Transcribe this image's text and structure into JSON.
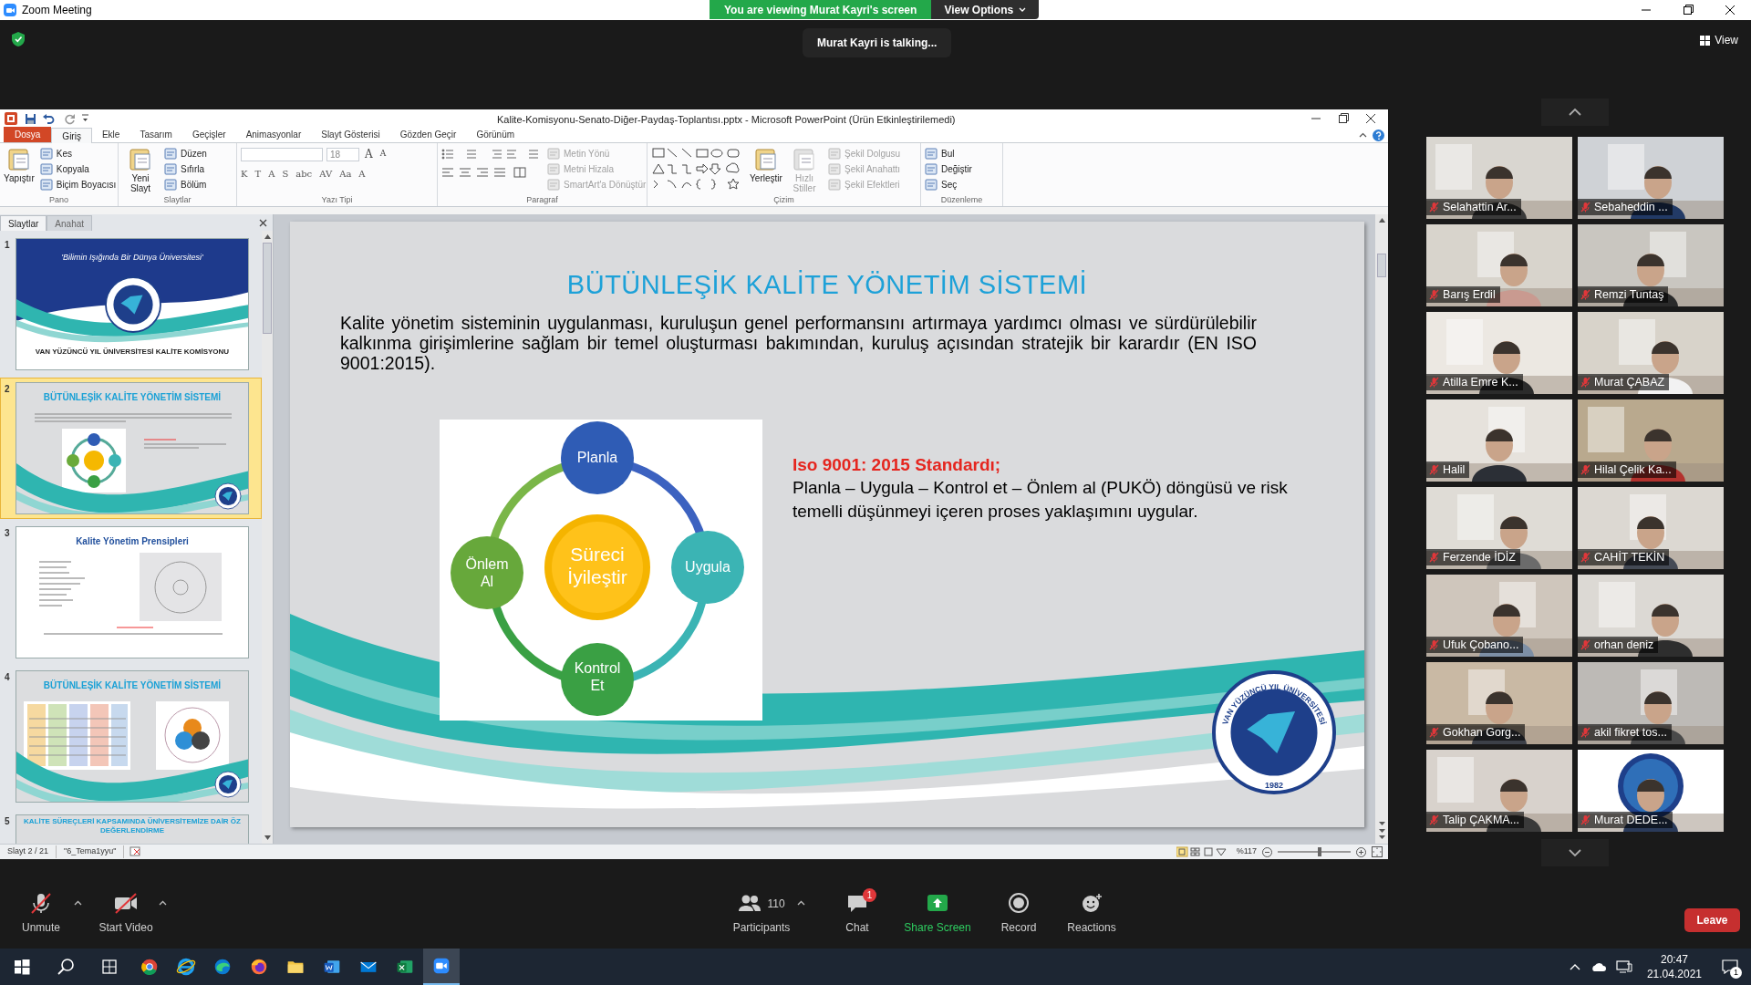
{
  "zoom": {
    "title": "Zoom Meeting"
  },
  "share_banner": {
    "message": "You are viewing Murat Kayri's screen",
    "view_options": "View Options"
  },
  "talking": "Murat Kayri is talking...",
  "view_button": "View",
  "powerpoint": {
    "title": "Kalite-Komisyonu-Senato-Diğer-Paydaş-Toplantısı.pptx - Microsoft PowerPoint (Ürün Etkinleştirilemedi)",
    "tabs": [
      {
        "label": "Dosya",
        "kind": "file",
        "selected": false
      },
      {
        "label": "Giriş",
        "kind": "tab",
        "selected": true
      },
      {
        "label": "Ekle",
        "kind": "tab",
        "selected": false
      },
      {
        "label": "Tasarım",
        "kind": "tab",
        "selected": false
      },
      {
        "label": "Geçişler",
        "kind": "tab",
        "selected": false
      },
      {
        "label": "Animasyonlar",
        "kind": "tab",
        "selected": false
      },
      {
        "label": "Slayt Gösterisi",
        "kind": "tab",
        "selected": false
      },
      {
        "label": "Gözden Geçir",
        "kind": "tab",
        "selected": false
      },
      {
        "label": "Görünüm",
        "kind": "tab",
        "selected": false
      }
    ],
    "ribbon": [
      {
        "label": "Pano",
        "kind": "commands",
        "items": [
          {
            "label": "Yapıştır",
            "kind": "large",
            "disabled": false
          },
          {
            "label": "Kes",
            "kind": "small",
            "disabled": false
          },
          {
            "label": "Kopyala",
            "kind": "small",
            "disabled": false
          },
          {
            "label": "Biçim Boyacısı",
            "kind": "small",
            "disabled": false
          }
        ]
      },
      {
        "label": "Slaytlar",
        "kind": "commands",
        "items": [
          {
            "label": "Yeni Slayt",
            "kind": "large",
            "disabled": false
          },
          {
            "label": "Düzen",
            "kind": "small",
            "disabled": false
          },
          {
            "label": "Sıfırla",
            "kind": "small",
            "disabled": false
          },
          {
            "label": "Bölüm",
            "kind": "small",
            "disabled": false
          }
        ]
      },
      {
        "label": "Yazı Tipi",
        "kind": "font",
        "size": "18",
        "size_buttons": [
          "A",
          "A"
        ],
        "glyphs": [
          "K",
          "T",
          "A",
          "S",
          "abc",
          "AV",
          "Aa",
          "A"
        ]
      },
      {
        "label": "Paragraf",
        "kind": "paragraph",
        "items": [
          {
            "label": "Metin Yönü",
            "kind": "small",
            "disabled": true
          },
          {
            "label": "Metni Hizala",
            "kind": "small",
            "disabled": true
          },
          {
            "label": "SmartArt'a Dönüştür",
            "kind": "small",
            "disabled": true
          }
        ]
      },
      {
        "label": "Çizim",
        "kind": "drawing",
        "items": [
          {
            "label": "Yerleştir",
            "kind": "large",
            "disabled": false
          },
          {
            "label": "Hızlı Stiller",
            "kind": "large",
            "disabled": true
          },
          {
            "label": "Şekil Dolgusu",
            "kind": "small",
            "disabled": true
          },
          {
            "label": "Şekil Anahattı",
            "kind": "small",
            "disabled": true
          },
          {
            "label": "Şekil Efektleri",
            "kind": "small",
            "disabled": true
          }
        ]
      },
      {
        "label": "Düzenleme",
        "kind": "commands",
        "items": [
          {
            "label": "Bul",
            "kind": "small",
            "disabled": false
          },
          {
            "label": "Değiştir",
            "kind": "small",
            "disabled": false
          },
          {
            "label": "Seç",
            "kind": "small",
            "disabled": false
          }
        ]
      }
    ],
    "pane_tabs": [
      {
        "label": "Slaytlar",
        "selected": true
      },
      {
        "label": "Anahat",
        "selected": false
      }
    ],
    "thumbnails": [
      {
        "number": "1",
        "kind": "cover",
        "texts": [
          "'Bilimin Işığında Bir Dünya Üniversitesi'",
          "VAN YÜZÜNCÜ YIL ÜNİVERSİTESİ KALİTE KOMİSYONU"
        ],
        "selected": false
      },
      {
        "number": "2",
        "kind": "cycle",
        "texts": [
          "BÜTÜNLEŞİK KALİTE YÖNETİM SİSTEMİ"
        ],
        "selected": true
      },
      {
        "number": "3",
        "kind": "principles",
        "texts": [
          "Kalite Yönetim Prensipleri"
        ],
        "selected": false
      },
      {
        "number": "4",
        "kind": "tables",
        "texts": [
          "BÜTÜNLEŞİK KALİTE YÖNETİM SİSTEMİ"
        ],
        "selected": false
      },
      {
        "number": "5",
        "kind": "heading",
        "texts": [
          "KALİTE SÜREÇLERİ KAPSAMINDA ÜNİVERSİTEMİZE DAİR ÖZ DEĞERLENDİRME"
        ],
        "selected": false
      }
    ],
    "slide": {
      "title": "BÜTÜNLEŞİK KALİTE YÖNETİM SİSTEMİ",
      "paragraph": "Kalite yönetim sisteminin uygulanması, kuruluşun genel performansını artırmaya yardımcı olması ve sürdürülebilir kalkınma girişimlerine sağlam bir temel oluşturması bakımından, kuruluş açısından stratejik bir karardır (EN ISO 9001:2015).",
      "cycle": {
        "center": "Süreci İyileştir",
        "steps": [
          "Planla",
          "Uygula",
          "Kontrol Et",
          "Önlem Al"
        ]
      },
      "standard_heading": "Iso 9001: 2015 Standardı;",
      "standard_text": "Planla – Uygula – Kontrol et – Önlem al (PUKÖ) döngüsü ve risk temelli düşünmeyi içeren proses yaklaşımını uygular.",
      "logo": {
        "name": "VAN YÜZÜNCÜ YIL ÜNİVERSİTESİ",
        "year": "1982"
      }
    },
    "status": {
      "slide": "Slayt 2 / 21",
      "theme": "\"6_Tema1yyu\"",
      "zoom": "%117",
      "level": 0.58
    }
  },
  "participants": [
    {
      "name": "Selahattin Ar..."
    },
    {
      "name": "Sebaheddin ..."
    },
    {
      "name": "Barış Erdil"
    },
    {
      "name": "Remzi Tuntaş"
    },
    {
      "name": "Atilla Emre K..."
    },
    {
      "name": "Murat ÇABAZ"
    },
    {
      "name": "Halil"
    },
    {
      "name": "Hilal Çelik Ka..."
    },
    {
      "name": "Ferzende İDİZ"
    },
    {
      "name": "CAHİT TEKİN"
    },
    {
      "name": "Ufuk Çobano..."
    },
    {
      "name": "orhan deniz"
    },
    {
      "name": "Gokhan Gorg..."
    },
    {
      "name": "akil fikret tos..."
    },
    {
      "name": "Talip ÇAKMA..."
    },
    {
      "name": "Murat DEDE..."
    }
  ],
  "toolbar": [
    {
      "label": "Unmute",
      "kind": "mic"
    },
    {
      "label": "Start Video",
      "kind": "video"
    },
    {
      "label": "Participants",
      "kind": "participants",
      "count": "110"
    },
    {
      "label": "Chat",
      "kind": "chat",
      "badge": "1"
    },
    {
      "label": "Share Screen",
      "kind": "share"
    },
    {
      "label": "Record",
      "kind": "record"
    },
    {
      "label": "Reactions",
      "kind": "reactions"
    }
  ],
  "leave": "Leave",
  "taskbar": {
    "apps": [
      {
        "kind": "chrome",
        "selected": false
      },
      {
        "kind": "ie",
        "selected": false
      },
      {
        "kind": "edge",
        "selected": false
      },
      {
        "kind": "firefox",
        "selected": false
      },
      {
        "kind": "folder",
        "selected": false
      },
      {
        "kind": "word",
        "selected": false
      },
      {
        "kind": "mail",
        "selected": false
      },
      {
        "kind": "excel",
        "selected": false
      },
      {
        "kind": "zoom",
        "selected": true
      }
    ],
    "time": "20:47",
    "date": "21.04.2021",
    "notifications": "1"
  }
}
